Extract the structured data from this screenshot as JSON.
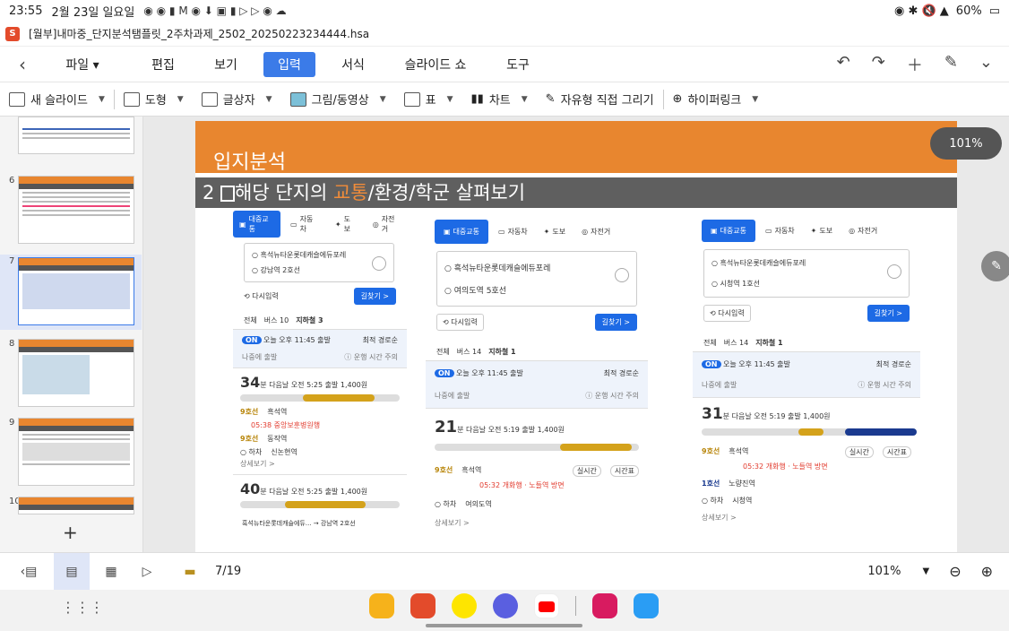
{
  "status": {
    "time": "23:55",
    "date": "2월 23일 일요일",
    "battery": "60%"
  },
  "file_title": "[월부]내마중_단지분석탬플릿_2주차과제_2502_20250223234444.hsa",
  "menu": {
    "items": [
      "파일",
      "편집",
      "보기",
      "입력",
      "서식",
      "슬라이드 쇼",
      "도구"
    ],
    "active": "입력"
  },
  "toolbar": {
    "new_slide": "새 슬라이드",
    "shape": "도형",
    "textbox": "글상자",
    "picture": "그림/동영상",
    "table": "표",
    "chart": "차트",
    "freeform": "자유형 직접 그리기",
    "hyperlink": "하이퍼링크"
  },
  "slide": {
    "title": "입지분석",
    "subtitle_pre": "2 ",
    "subtitle_mid": "해당 단지의 ",
    "subtitle_hl": "교통",
    "subtitle_post": "/환경/학군 살펴보기",
    "zoom_badge": "101%"
  },
  "thumbnails": [
    {
      "num": "6"
    },
    {
      "num": "7"
    },
    {
      "num": "8"
    },
    {
      "num": "9"
    },
    {
      "num": "10"
    }
  ],
  "panels": {
    "common": {
      "tab_transit": "대중교통",
      "tab_car": "자동차",
      "tab_walk": "도보",
      "tab_bike": "자전거",
      "reset": "다시입력",
      "go": "길찾기 >",
      "all": "전체",
      "late": "나중에 출발",
      "on": "ON"
    },
    "p1": {
      "from": "흑석뉴타운롯데캐슬에듀포레",
      "to": "강남역 2호선",
      "bus": "버스 10",
      "subway": "지하철 3",
      "time": "오늘 오후 11:45 출발",
      "sort": "최적 경로순",
      "info": "운행 시간 주의",
      "r1": {
        "min": "34",
        "unit": "분",
        "detail": "다음날 오전 5:25 출발",
        "fare": "1,400원"
      },
      "s1": {
        "line": "9호선",
        "name": "흑석역",
        "sub": "05:38 중앙보훈병원행"
      },
      "s2": {
        "line": "9호선",
        "name": "동작역"
      },
      "s3": {
        "line": "하차",
        "name": "신논현역"
      },
      "more": "상세보기 >",
      "r2": {
        "min": "40",
        "unit": "분",
        "detail": "다음날 오전 5:25 출발",
        "fare": "1,400원"
      },
      "footer": "흑석뉴타운롯데캐슬에듀... → 강남역 2호선"
    },
    "p2": {
      "from": "흑석뉴타운롯데캐슬에듀포레",
      "to": "여의도역 5호선",
      "bus": "버스 14",
      "subway": "지하철 1",
      "time": "오늘 오후 11:45 출발",
      "sort": "최적 경로순",
      "info": "운행 시간 주의",
      "r1": {
        "min": "21",
        "unit": "분",
        "detail": "다음날 오전 5:19 출발",
        "fare": "1,400원"
      },
      "s1": {
        "line": "9호선",
        "name": "흑석역",
        "sub": "05:32 개화행 · 노들역 방면"
      },
      "s3": {
        "line": "하차",
        "name": "여의도역"
      },
      "more": "상세보기 >",
      "realtime": "실시간",
      "timetable": "시간표"
    },
    "p3": {
      "from": "흑석뉴타운롯데캐슬에듀포레",
      "to": "시청역 1호선",
      "bus": "버스 14",
      "subway": "지하철 1",
      "time": "오늘 오후 11:45 출발",
      "sort": "최적 경로순",
      "info": "운행 시간 주의",
      "r1": {
        "min": "31",
        "unit": "분",
        "detail": "다음날 오전 5:19 출발",
        "fare": "1,400원"
      },
      "s1": {
        "line": "9호선",
        "name": "흑석역",
        "sub": "05:32 개화행 · 노들역 방면"
      },
      "s2": {
        "line": "1호선",
        "name": "노량진역"
      },
      "s3": {
        "line": "하차",
        "name": "시청역"
      },
      "more": "상세보기 >",
      "realtime": "실시간",
      "timetable": "시간표"
    }
  },
  "bottom": {
    "page": "7/19",
    "zoom": "101%"
  }
}
